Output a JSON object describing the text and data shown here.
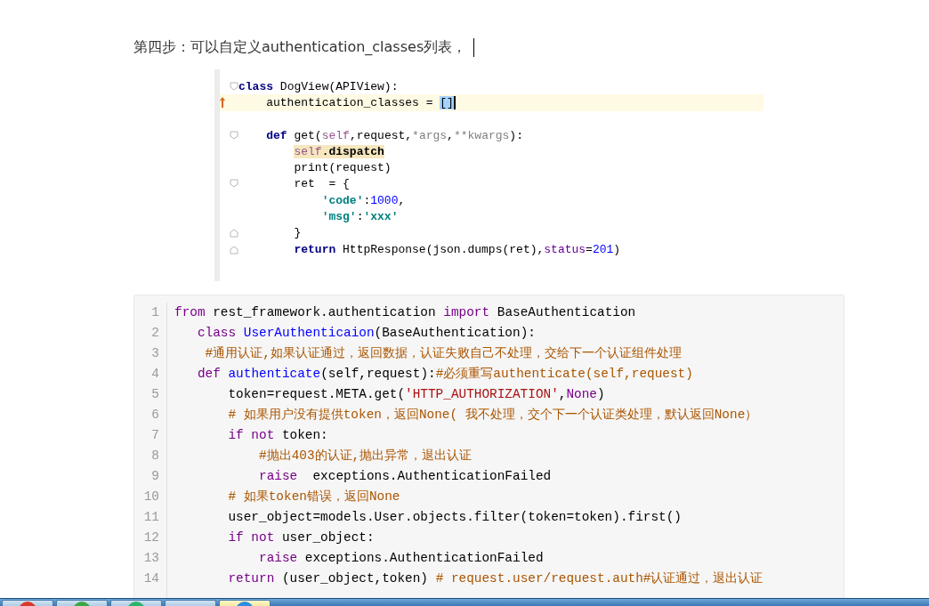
{
  "heading": "第四步：可以自定义authentication_classes列表，",
  "ide_screenshot": {
    "lines": [
      {
        "kind": "foldstart",
        "tokens": [
          {
            "kind": "keyword",
            "text": "class"
          },
          {
            "kind": "plain",
            "text": " DogView(APIView):"
          }
        ]
      },
      {
        "kind": "current",
        "tokens": [
          {
            "kind": "plain",
            "text": "    authentication_classes = "
          },
          {
            "kind": "selected",
            "text": "[]"
          }
        ]
      },
      {
        "kind": "plain"
      },
      {
        "kind": "foldstart",
        "tokens": [
          {
            "kind": "keyword",
            "text": "    def"
          },
          {
            "kind": "plain",
            "text": " get("
          },
          {
            "kind": "self",
            "text": "self"
          },
          {
            "kind": "plain",
            "text": ",request,"
          },
          {
            "kind": "param",
            "text": "*args"
          },
          {
            "kind": "plain",
            "text": ","
          },
          {
            "kind": "param",
            "text": "**kwargs"
          },
          {
            "kind": "plain",
            "text": "):"
          }
        ]
      },
      {
        "kind": "plain",
        "tokens": [
          {
            "kind": "marked_self",
            "text": "        self"
          },
          {
            "kind": "marked_plain",
            "text": ".dispatch"
          }
        ]
      },
      {
        "kind": "plain",
        "tokens": [
          {
            "kind": "plain",
            "text": "        print(request)"
          }
        ]
      },
      {
        "kind": "foldstart",
        "tokens": [
          {
            "kind": "plain",
            "text": "        ret  = {"
          }
        ]
      },
      {
        "kind": "plain",
        "tokens": [
          {
            "kind": "string",
            "text": "            'code'"
          },
          {
            "kind": "plain",
            "text": ":"
          },
          {
            "kind": "number",
            "text": "1000"
          },
          {
            "kind": "plain",
            "text": ","
          }
        ]
      },
      {
        "kind": "plain",
        "tokens": [
          {
            "kind": "string",
            "text": "            'msg'"
          },
          {
            "kind": "plain",
            "text": ":"
          },
          {
            "kind": "string",
            "text": "'xxx'"
          }
        ]
      },
      {
        "kind": "foldend",
        "tokens": [
          {
            "kind": "plain",
            "text": "        }"
          }
        ]
      },
      {
        "kind": "foldend",
        "tokens": [
          {
            "kind": "keyword",
            "text": "        return"
          },
          {
            "kind": "plain",
            "text": " HttpResponse(json.dumps(ret),"
          },
          {
            "kind": "kwarg",
            "text": "status"
          },
          {
            "kind": "plain",
            "text": "="
          },
          {
            "kind": "number",
            "text": "201"
          },
          {
            "kind": "plain",
            "text": ")"
          }
        ]
      }
    ]
  },
  "code_block": {
    "lines": [
      {
        "number": "1",
        "tokens": [
          {
            "kind": "keyword",
            "text": "from"
          },
          {
            "kind": "plain",
            "text": " rest_framework.authentication "
          },
          {
            "kind": "keyword",
            "text": "import"
          },
          {
            "kind": "plain",
            "text": " BaseAuthentication"
          }
        ]
      },
      {
        "number": "2",
        "tokens": [
          {
            "kind": "keyword",
            "text": "   class "
          },
          {
            "kind": "name",
            "text": "UserAuthenticaion"
          },
          {
            "kind": "plain",
            "text": "(BaseAuthentication):"
          }
        ]
      },
      {
        "number": "3",
        "tokens": [
          {
            "kind": "comment",
            "text": "    #通用认证,如果认证通过，返回数据，认证失败自己不处理，交给下一个认证组件处理"
          }
        ]
      },
      {
        "number": "4",
        "tokens": [
          {
            "kind": "keyword",
            "text": "   def "
          },
          {
            "kind": "name",
            "text": "authenticate"
          },
          {
            "kind": "plain",
            "text": "(self,request):"
          },
          {
            "kind": "comment",
            "text": "#必须重写authenticate(self,request)"
          }
        ]
      },
      {
        "number": "5",
        "tokens": [
          {
            "kind": "plain",
            "text": "       token=request.META.get("
          },
          {
            "kind": "string",
            "text": "'HTTP_AUTHORIZATION'"
          },
          {
            "kind": "plain",
            "text": ","
          },
          {
            "kind": "keyword",
            "text": "None"
          },
          {
            "kind": "plain",
            "text": ")"
          }
        ]
      },
      {
        "number": "6",
        "tokens": [
          {
            "kind": "comment",
            "text": "       # 如果用户没有提供token，返回None( 我不处理，交个下一个认证类处理，默认返回None）"
          }
        ]
      },
      {
        "number": "7",
        "tokens": [
          {
            "kind": "keyword",
            "text": "       if not"
          },
          {
            "kind": "plain",
            "text": " token:"
          }
        ]
      },
      {
        "number": "8",
        "tokens": [
          {
            "kind": "comment",
            "text": "           #抛出403的认证,抛出异常，退出认证"
          }
        ]
      },
      {
        "number": "9",
        "tokens": [
          {
            "kind": "keyword",
            "text": "           raise"
          },
          {
            "kind": "plain",
            "text": "  exceptions.AuthenticationFailed"
          }
        ]
      },
      {
        "number": "10",
        "tokens": [
          {
            "kind": "comment",
            "text": "       # 如果token错误，返回None"
          }
        ]
      },
      {
        "number": "11",
        "tokens": [
          {
            "kind": "plain",
            "text": "       user_object=models.User.objects.filter(token=token).first()"
          }
        ]
      },
      {
        "number": "12",
        "tokens": [
          {
            "kind": "keyword",
            "text": "       if not"
          },
          {
            "kind": "plain",
            "text": " user_object:"
          }
        ]
      },
      {
        "number": "13",
        "tokens": [
          {
            "kind": "keyword",
            "text": "           raise"
          },
          {
            "kind": "plain",
            "text": " exceptions.AuthenticationFailed"
          }
        ]
      },
      {
        "number": "14",
        "tokens": [
          {
            "kind": "keyword",
            "text": "       return"
          },
          {
            "kind": "plain",
            "text": " (user_object,token) "
          },
          {
            "kind": "comment",
            "text": "# request.user/request.auth#认证通过，退出认证"
          }
        ]
      }
    ]
  },
  "taskbar": {
    "buttons": [
      {
        "selected": false,
        "color": "#d83a2a"
      },
      {
        "selected": false,
        "color": "#3aa845"
      },
      {
        "selected": false,
        "color": "#2db36b"
      },
      {
        "selected": false
      },
      {
        "selected": true,
        "color": "#2a8de0"
      }
    ]
  }
}
